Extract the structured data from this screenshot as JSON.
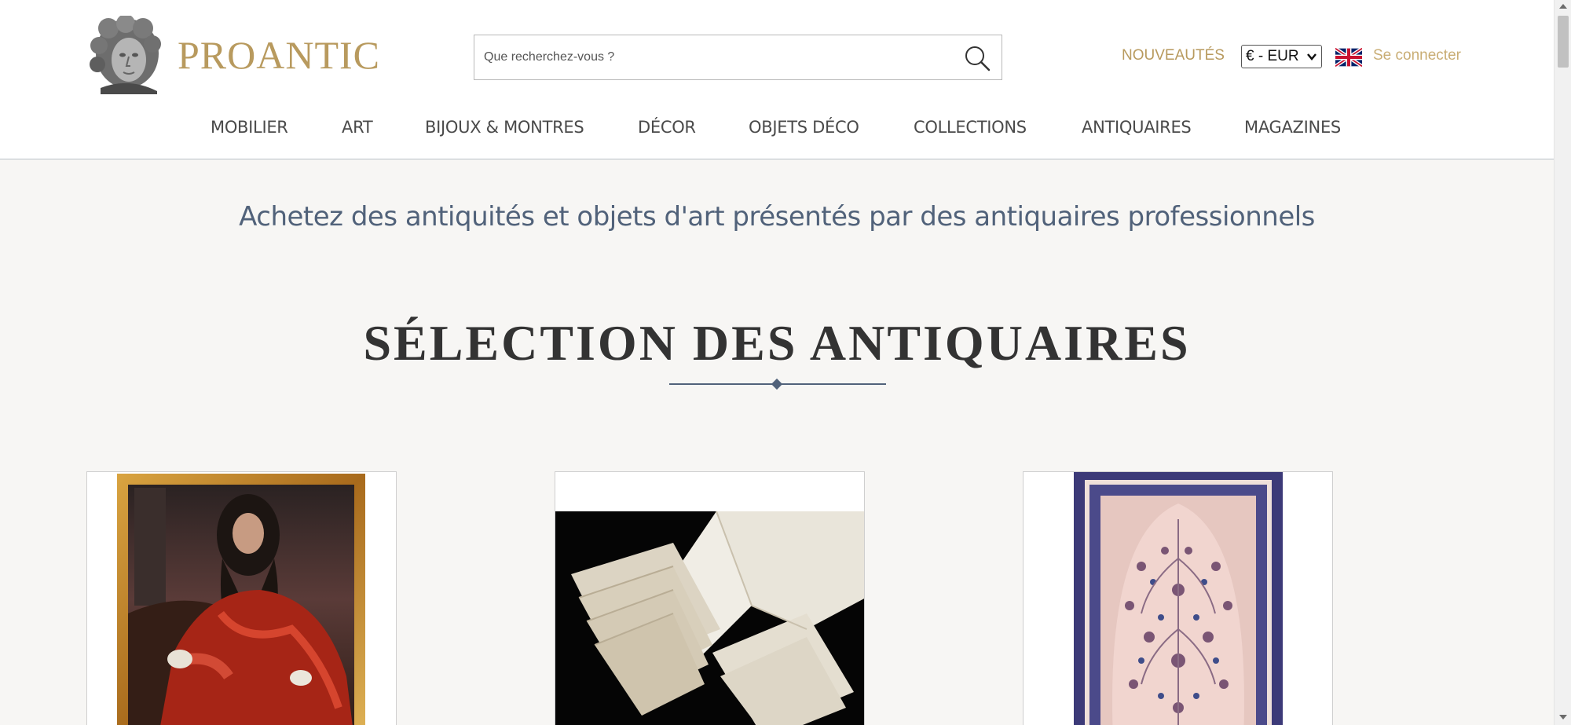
{
  "header": {
    "logo_text": "PROANTIC",
    "search_placeholder": "Que recherchez-vous ?",
    "nouveautes_label": "NOUVEAUTÉS",
    "currency_selected": "€ - EUR",
    "language_flag": "uk-flag-icon",
    "login_label": "Se connecter"
  },
  "nav": {
    "items": [
      {
        "label": "MOBILIER"
      },
      {
        "label": "ART"
      },
      {
        "label": "BIJOUX & MONTRES"
      },
      {
        "label": "DÉCOR"
      },
      {
        "label": "OBJETS DÉCO"
      },
      {
        "label": "COLLECTIONS"
      },
      {
        "label": "ANTIQUAIRES"
      },
      {
        "label": "MAGAZINES"
      }
    ]
  },
  "main": {
    "tagline": "Achetez des antiquités et objets d'art présentés par des antiquaires professionnels",
    "section_title": "SÉLECTION DES ANTIQUAIRES"
  },
  "colors": {
    "brand_gold": "#b89a5e",
    "login_gold": "#c9ad74",
    "accent_slate": "#51627a",
    "page_background": "#f7f6f4"
  }
}
